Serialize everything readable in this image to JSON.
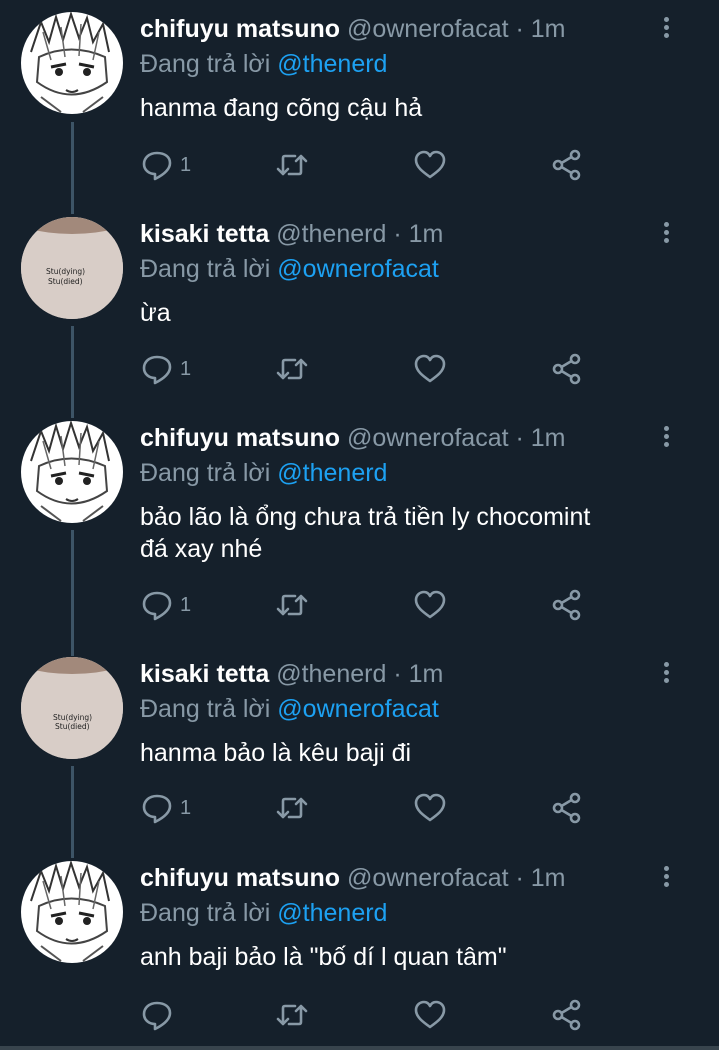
{
  "replying_prefix": "Đang trả lời",
  "tweets": [
    {
      "display_name": "chifuyu matsuno",
      "handle": "@ownerofacat",
      "time": "1m",
      "reply_to": "@thenerd",
      "text": "hanma đang cõng cậu hả",
      "reply_count": "1",
      "avatar": "manga-portrait"
    },
    {
      "display_name": "kisaki tetta",
      "handle": "@thenerd",
      "time": "1m",
      "reply_to": "@ownerofacat",
      "text": "ừa",
      "reply_count": "1",
      "avatar": "shirt",
      "shirt_text": [
        "Stu(dying)",
        "Stu(died)"
      ]
    },
    {
      "display_name": "chifuyu matsuno",
      "handle": "@ownerofacat",
      "time": "1m",
      "reply_to": "@thenerd",
      "text_lines": [
        "bảo lão là ổng chưa trả tiền ly chocomint",
        "đá xay nhé"
      ],
      "reply_count": "1",
      "avatar": "manga-portrait"
    },
    {
      "display_name": "kisaki tetta",
      "handle": "@thenerd",
      "time": "1m",
      "reply_to": "@ownerofacat",
      "text": "hanma bảo là kêu baji đi",
      "reply_count": "1",
      "avatar": "shirt",
      "shirt_text": [
        "Stu(dying)",
        "Stu(died)"
      ]
    },
    {
      "display_name": "chifuyu matsuno",
      "handle": "@ownerofacat",
      "time": "1m",
      "reply_to": "@thenerd",
      "text": "anh baji bảo là \"bố dí l quan tâm\"",
      "reply_count": "",
      "avatar": "manga-portrait"
    }
  ],
  "icons": [
    "reply-icon",
    "retweet-icon",
    "like-icon",
    "share-icon",
    "more-icon"
  ],
  "colors": {
    "background": "#15202b",
    "primary_text": "#ffffff",
    "secondary_text": "#8899a6",
    "mention": "#1da1f2",
    "thread_line": "#3d5466"
  }
}
